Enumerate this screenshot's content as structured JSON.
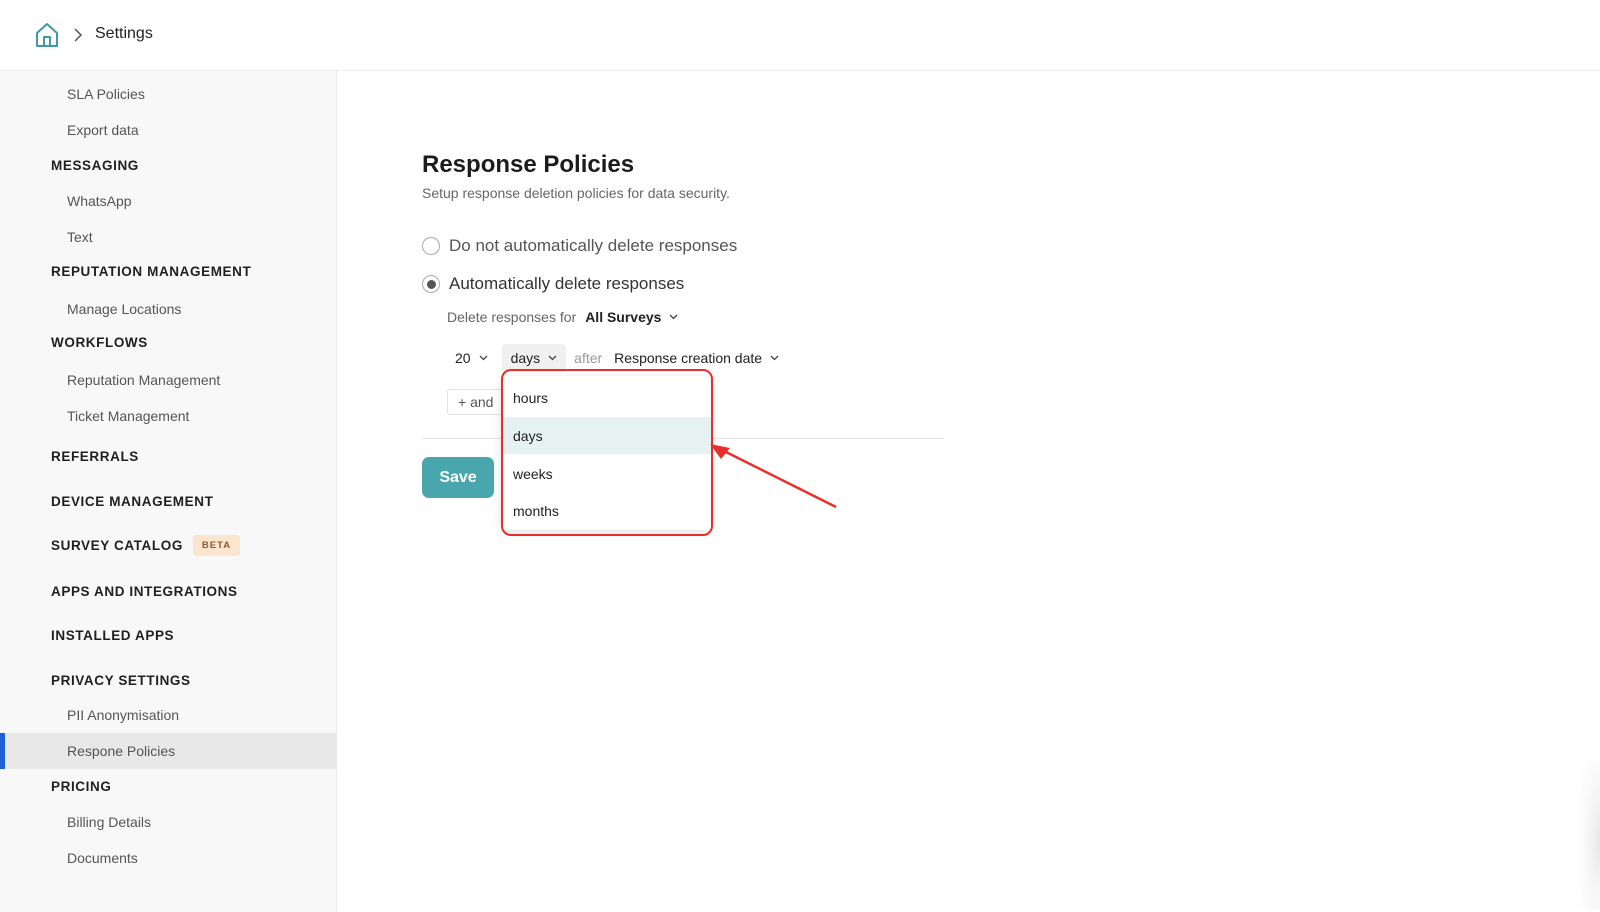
{
  "header": {
    "breadcrumb_title": "Settings"
  },
  "sidebar": {
    "items": [
      {
        "type": "item",
        "label": "SLA Policies"
      },
      {
        "type": "item",
        "label": "Export data"
      },
      {
        "type": "section",
        "label": "MESSAGING"
      },
      {
        "type": "item",
        "label": "WhatsApp"
      },
      {
        "type": "item",
        "label": "Text"
      },
      {
        "type": "section",
        "label": "REPUTATION MANAGEMENT"
      },
      {
        "type": "item",
        "label": "Manage Locations"
      },
      {
        "type": "section",
        "label": "WORKFLOWS"
      },
      {
        "type": "item",
        "label": "Reputation Management"
      },
      {
        "type": "item",
        "label": "Ticket Management"
      },
      {
        "type": "section",
        "label": "REFERRALS"
      },
      {
        "type": "section",
        "label": "DEVICE MANAGEMENT"
      },
      {
        "type": "section",
        "label": "SURVEY CATALOG",
        "badge": "BETA"
      },
      {
        "type": "section",
        "label": "APPS AND INTEGRATIONS"
      },
      {
        "type": "section",
        "label": "INSTALLED APPS"
      },
      {
        "type": "section",
        "label": "PRIVACY SETTINGS"
      },
      {
        "type": "item",
        "label": "PII Anonymisation"
      },
      {
        "type": "item",
        "label": "Respone Policies",
        "active": true
      },
      {
        "type": "section",
        "label": "PRICING"
      },
      {
        "type": "item",
        "label": "Billing Details"
      },
      {
        "type": "item",
        "label": "Documents"
      }
    ]
  },
  "main": {
    "title": "Response Policies",
    "subtitle": "Setup response deletion policies for data security.",
    "options": [
      {
        "label": "Do not automatically delete responses",
        "checked": false
      },
      {
        "label": "Automatically delete responses",
        "checked": true
      }
    ],
    "delete_for": {
      "label": "Delete responses for",
      "value": "All Surveys"
    },
    "rule": {
      "amount": "20",
      "unit": "days",
      "connector": "after",
      "reference": "Response creation date"
    },
    "add_condition_label": "+ and",
    "save_label": "Save"
  },
  "unit_dropdown": {
    "options": [
      "hours",
      "days",
      "weeks",
      "months"
    ],
    "selected": "days"
  },
  "colors": {
    "accent": "#4aa6ad",
    "active_indicator": "#1f5fd6",
    "annotation": "#e8302a",
    "dropdown_selected": "#e6f1f1"
  }
}
